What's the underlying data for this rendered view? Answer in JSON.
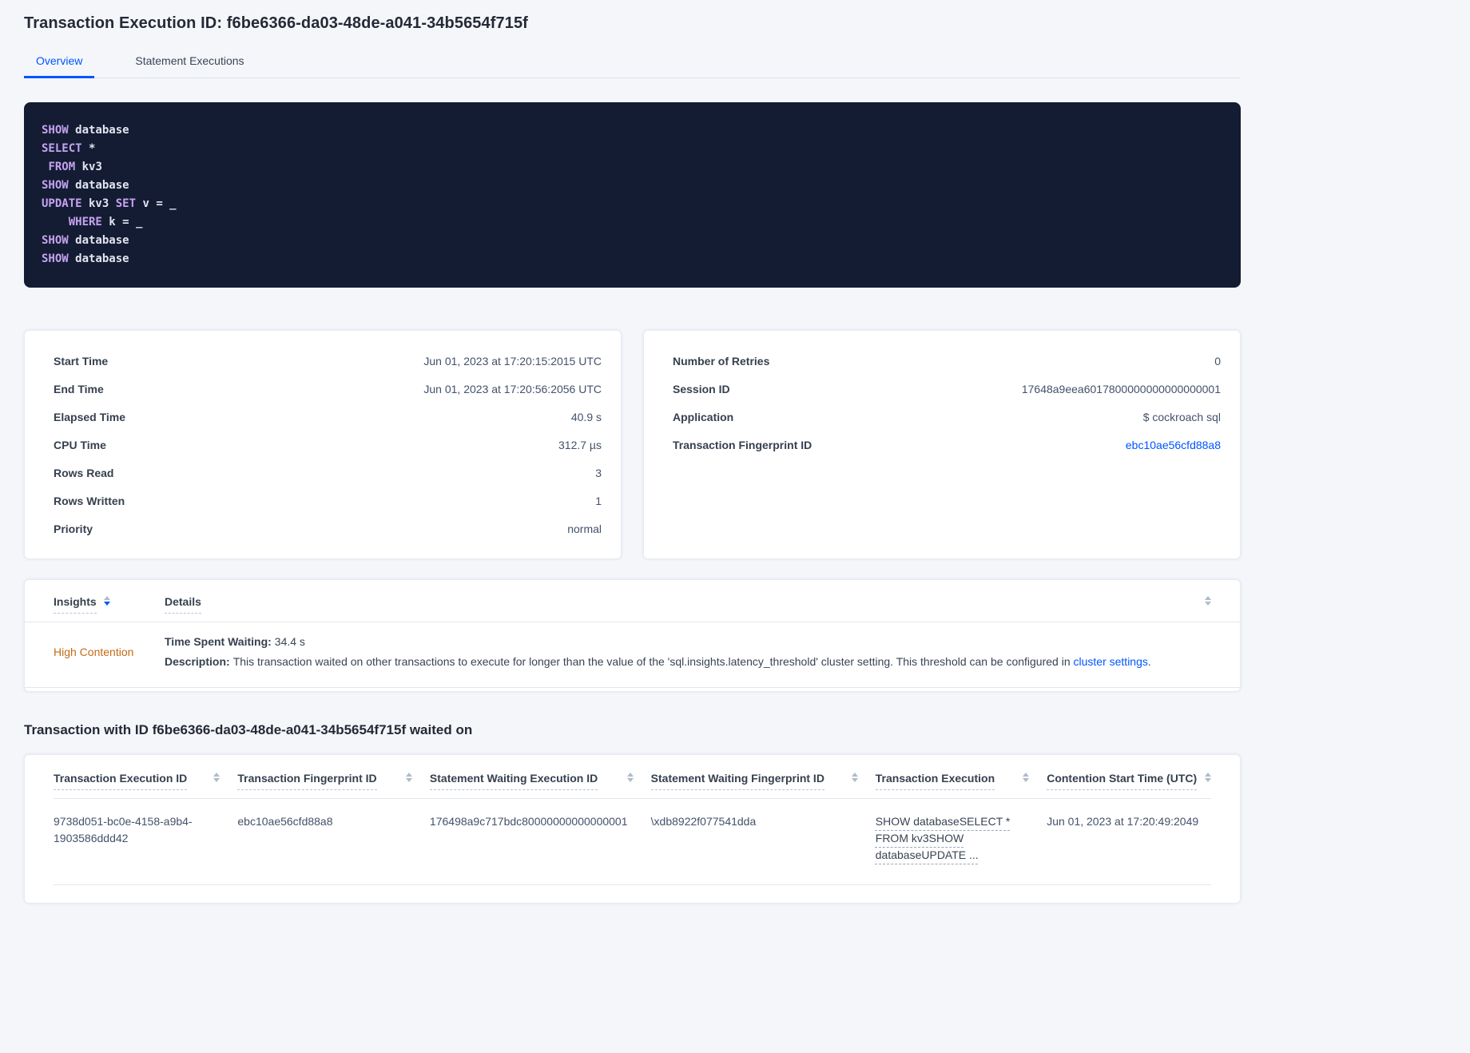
{
  "page": {
    "title": "Transaction Execution ID: f6be6366-da03-48de-a041-34b5654f715f"
  },
  "tabs": {
    "overview": "Overview",
    "statement_executions": "Statement Executions"
  },
  "sql": {
    "l1": {
      "a": "SHOW",
      "b": " database"
    },
    "l2": {
      "a": "SELECT",
      "b": " *"
    },
    "l3": {
      "a": " ",
      "b": "FROM",
      "c": " kv3"
    },
    "l4": {
      "a": "SHOW",
      "b": " database"
    },
    "l5": {
      "a": "UPDATE",
      "b": " kv3 ",
      "c": "SET",
      "d": " v = _"
    },
    "l6": {
      "a": "    ",
      "b": "WHERE",
      "c": " k = _"
    },
    "l7": {
      "a": "SHOW",
      "b": " database"
    },
    "l8": {
      "a": "SHOW",
      "b": " database"
    }
  },
  "summary_left": {
    "rows": [
      {
        "label": "Start Time",
        "value": "Jun 01, 2023 at 17:20:15:2015 UTC"
      },
      {
        "label": "End Time",
        "value": "Jun 01, 2023 at 17:20:56:2056 UTC"
      },
      {
        "label": "Elapsed Time",
        "value": "40.9 s"
      },
      {
        "label": "CPU Time",
        "value": "312.7 µs"
      },
      {
        "label": "Rows Read",
        "value": "3"
      },
      {
        "label": "Rows Written",
        "value": "1"
      },
      {
        "label": "Priority",
        "value": "normal"
      }
    ]
  },
  "summary_right": {
    "rows": [
      {
        "label": "Number of Retries",
        "value": "0"
      },
      {
        "label": "Session ID",
        "value": "17648a9eea6017800000000000000001"
      },
      {
        "label": "Application",
        "value": "$ cockroach sql"
      },
      {
        "label": "Transaction Fingerprint ID",
        "value": "ebc10ae56cfd88a8"
      }
    ]
  },
  "insights": {
    "columns": {
      "insights": "Insights",
      "details": "Details"
    },
    "row": {
      "insight": "High Contention",
      "waiting_label": "Time Spent Waiting:",
      "waiting_value": "34.4 s",
      "description_label": "Description:",
      "description_text": "This transaction waited on other transactions to execute for longer than the value of the 'sql.insights.latency_threshold' cluster setting. This threshold can be configured in ",
      "description_link": "cluster settings",
      "description_suffix": "."
    }
  },
  "waited_on": {
    "title": "Transaction with ID f6be6366-da03-48de-a041-34b5654f715f waited on",
    "columns": [
      "Transaction Execution ID",
      "Transaction Fingerprint ID",
      "Statement Waiting Execution ID",
      "Statement Waiting Fingerprint ID",
      "Transaction Execution",
      "Contention Start Time (UTC)"
    ],
    "rows": [
      {
        "transaction_execution_id": "9738d051-bc0e-4158-a9b4-1903586ddd42",
        "transaction_fingerprint_id": "ebc10ae56cfd88a8",
        "statement_waiting_execution_id": "176498a9c717bdc80000000000000001",
        "statement_waiting_fingerprint_id": "\\xdb8922f077541dda",
        "transaction_execution": "SHOW databaseSELECT * FROM kv3SHOW databaseUPDATE ...",
        "contention_start_time": "Jun 01, 2023 at 17:20:49:2049"
      }
    ]
  },
  "colors": {
    "accent": "#0055ff",
    "high_contention": "#c36a17",
    "sql_keyword": "#c5a3f0",
    "sql_plain": "#e2e4f0",
    "sql_background": "#141c33"
  }
}
